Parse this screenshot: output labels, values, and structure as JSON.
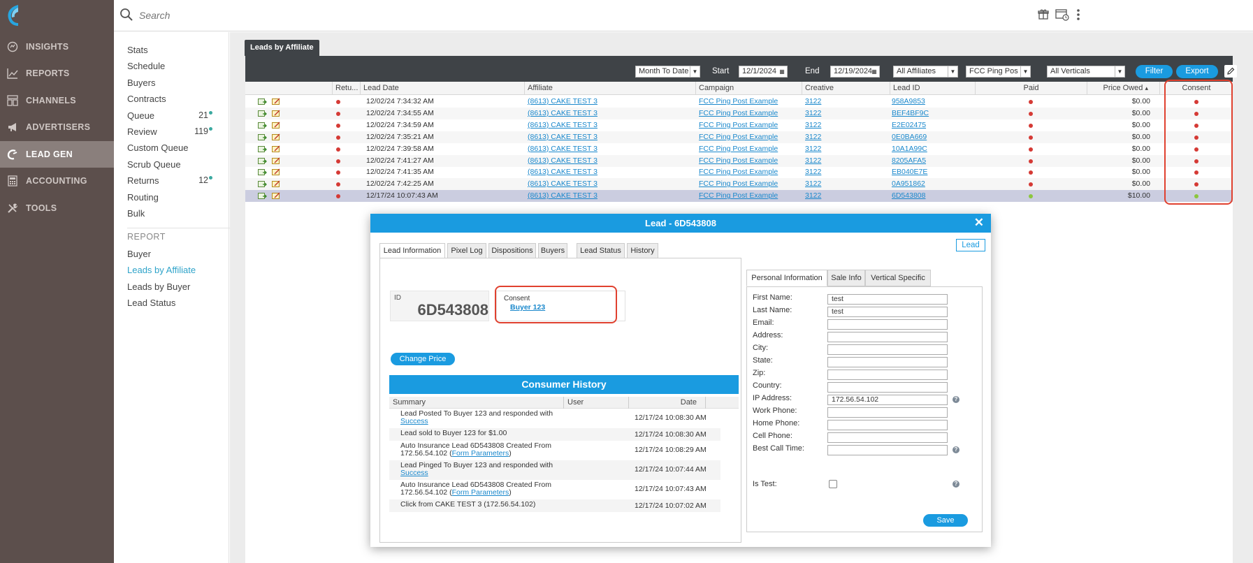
{
  "nav": {
    "items": [
      {
        "label": "INSIGHTS",
        "icon": "insights-icon"
      },
      {
        "label": "REPORTS",
        "icon": "reports-icon"
      },
      {
        "label": "CHANNELS",
        "icon": "channels-icon"
      },
      {
        "label": "ADVERTISERS",
        "icon": "megaphone-icon"
      },
      {
        "label": "LEAD GEN",
        "icon": "magnet-icon",
        "active": true
      },
      {
        "label": "ACCOUNTING",
        "icon": "calculator-icon"
      },
      {
        "label": "TOOLS",
        "icon": "tools-icon"
      }
    ]
  },
  "topbar": {
    "search_placeholder": "Search"
  },
  "subnav": {
    "items": [
      {
        "label": "Stats"
      },
      {
        "label": "Schedule"
      },
      {
        "label": "Buyers"
      },
      {
        "label": "Contracts"
      },
      {
        "label": "Queue",
        "count": "21"
      },
      {
        "label": "Review",
        "count": "119"
      },
      {
        "label": "Custom Queue"
      },
      {
        "label": "Scrub Queue"
      },
      {
        "label": "Returns",
        "count": "12"
      },
      {
        "label": "Routing"
      },
      {
        "label": "Bulk"
      }
    ],
    "report_section": "REPORT",
    "report_items": [
      {
        "label": "Buyer"
      },
      {
        "label": "Leads by Affiliate",
        "active": true
      },
      {
        "label": "Leads by Buyer"
      },
      {
        "label": "Lead Status"
      }
    ]
  },
  "page_tab": "Leads by Affiliate",
  "toolbar": {
    "period": "Month To Date",
    "start_label": "Start",
    "start_value": "12/1/2024",
    "end_label": "End",
    "end_value": "12/19/2024",
    "affiliates": "All Affiliates",
    "campaign": "FCC Ping Pos",
    "verticals": "All Verticals",
    "filter_label": "Filter",
    "export_label": "Export"
  },
  "table": {
    "headers": [
      "Retu...",
      "Lead Date",
      "Affiliate",
      "Campaign",
      "Creative",
      "Lead ID",
      "Paid",
      "Price Owed",
      "Consent"
    ],
    "sort_indicator": "▴",
    "rows": [
      {
        "date": "12/02/24 7:34:32 AM",
        "affiliate": "(8613) CAKE TEST 3",
        "campaign": "FCC Ping Post Example",
        "creative": "3122",
        "lead_id": "958A9853",
        "paid": "red",
        "price": "$0.00",
        "consent": "red"
      },
      {
        "date": "12/02/24 7:34:55 AM",
        "affiliate": "(8613) CAKE TEST 3",
        "campaign": "FCC Ping Post Example",
        "creative": "3122",
        "lead_id": "BEF4BF9C",
        "paid": "red",
        "price": "$0.00",
        "consent": "red"
      },
      {
        "date": "12/02/24 7:34:59 AM",
        "affiliate": "(8613) CAKE TEST 3",
        "campaign": "FCC Ping Post Example",
        "creative": "3122",
        "lead_id": "E2E02475",
        "paid": "red",
        "price": "$0.00",
        "consent": "red"
      },
      {
        "date": "12/02/24 7:35:21 AM",
        "affiliate": "(8613) CAKE TEST 3",
        "campaign": "FCC Ping Post Example",
        "creative": "3122",
        "lead_id": "0E0BA669",
        "paid": "red",
        "price": "$0.00",
        "consent": "red"
      },
      {
        "date": "12/02/24 7:39:58 AM",
        "affiliate": "(8613) CAKE TEST 3",
        "campaign": "FCC Ping Post Example",
        "creative": "3122",
        "lead_id": "10A1A99C",
        "paid": "red",
        "price": "$0.00",
        "consent": "red"
      },
      {
        "date": "12/02/24 7:41:27 AM",
        "affiliate": "(8613) CAKE TEST 3",
        "campaign": "FCC Ping Post Example",
        "creative": "3122",
        "lead_id": "8205AFA5",
        "paid": "red",
        "price": "$0.00",
        "consent": "red"
      },
      {
        "date": "12/02/24 7:41:35 AM",
        "affiliate": "(8613) CAKE TEST 3",
        "campaign": "FCC Ping Post Example",
        "creative": "3122",
        "lead_id": "EB040E7E",
        "paid": "red",
        "price": "$0.00",
        "consent": "red"
      },
      {
        "date": "12/02/24 7:42:25 AM",
        "affiliate": "(8613) CAKE TEST 3",
        "campaign": "FCC Ping Post Example",
        "creative": "3122",
        "lead_id": "0A951862",
        "paid": "red",
        "price": "$0.00",
        "consent": "red"
      },
      {
        "date": "12/17/24 10:07:43 AM",
        "affiliate": "(8613) CAKE TEST 3",
        "campaign": "FCC Ping Post Example",
        "creative": "3122",
        "lead_id": "6D543808",
        "paid": "green",
        "price": "$10.00",
        "consent": "green",
        "selected": true
      }
    ]
  },
  "modal": {
    "title": "Lead - 6D543808",
    "close": "✕",
    "lead_button": "Lead",
    "tabs": [
      "Lead Information",
      "Pixel Log",
      "Dispositions",
      "Buyers",
      "Lead Status",
      "History"
    ],
    "id_label": "ID",
    "id_value": "6D543808",
    "consent_label": "Consent",
    "consent_value": "Buyer 123",
    "change_price": "Change Price",
    "history_title": "Consumer History",
    "history_cols": [
      "Summary",
      "User",
      "Date"
    ],
    "history": [
      {
        "text": "Lead Posted To Buyer 123 and responded with",
        "link": "Success",
        "after": "",
        "date": "12/17/24 10:08:30 AM"
      },
      {
        "text": "Lead sold to Buyer 123 for $1.00",
        "link": "",
        "after": "",
        "date": "12/17/24 10:08:30 AM"
      },
      {
        "text": "Auto Insurance Lead 6D543808 Created From 172.56.54.102 (",
        "link": "Form Parameters",
        "after": ")",
        "date": "12/17/24 10:08:29 AM"
      },
      {
        "text": "Lead Pinged To Buyer 123 and responded with",
        "link": "Success",
        "after": "",
        "date": "12/17/24 10:07:44 AM"
      },
      {
        "text": "Auto Insurance Lead 6D543808 Created From 172.56.54.102 (",
        "link": "Form Parameters",
        "after": ")",
        "date": "12/17/24 10:07:43 AM"
      },
      {
        "text": "Click from CAKE TEST 3 (172.56.54.102)",
        "link": "",
        "after": "",
        "date": "12/17/24 10:07:02 AM"
      }
    ],
    "right_tabs": [
      "Personal Information",
      "Sale Info",
      "Vertical Specific"
    ],
    "fields": [
      {
        "label": "First Name:",
        "value": "test"
      },
      {
        "label": "Last Name:",
        "value": "test"
      },
      {
        "label": "Email:",
        "value": ""
      },
      {
        "label": "Address:",
        "value": ""
      },
      {
        "label": "City:",
        "value": ""
      },
      {
        "label": "State:",
        "value": ""
      },
      {
        "label": "Zip:",
        "value": ""
      },
      {
        "label": "Country:",
        "value": ""
      },
      {
        "label": "IP Address:",
        "value": "172.56.54.102",
        "help": true
      },
      {
        "label": "Work Phone:",
        "value": ""
      },
      {
        "label": "Home Phone:",
        "value": ""
      },
      {
        "label": "Cell Phone:",
        "value": ""
      },
      {
        "label": "Best Call Time:",
        "value": "",
        "help": true
      }
    ],
    "is_test_label": "Is Test:",
    "help_glyph": "?",
    "save": "Save"
  },
  "colors": {
    "accent": "#1a9be0",
    "nav_bg": "#5c4f4c",
    "highlight": "#e0412f",
    "red_dot": "#d53a35",
    "green_dot": "#8cc63f"
  }
}
